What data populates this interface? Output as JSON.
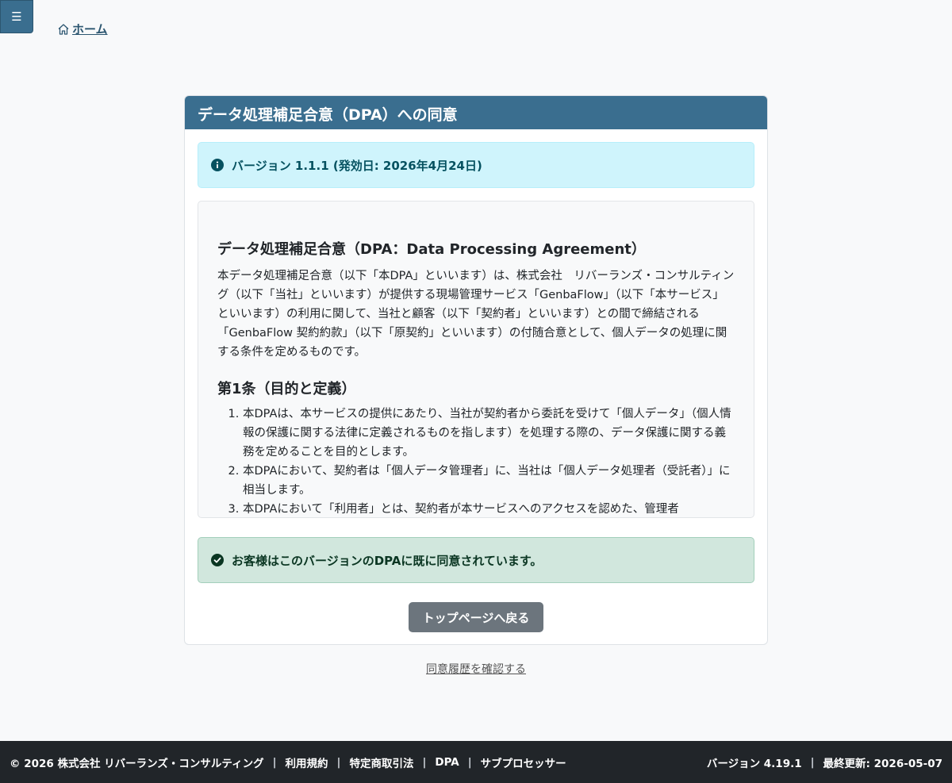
{
  "nav": {
    "menu_icon": "☰",
    "home_label": "ホーム"
  },
  "card": {
    "title": "データ処理補足合意（DPA）への同意"
  },
  "version_alert": {
    "text": "バージョン 1.1.1 (発効日: 2026年4月24日)"
  },
  "dpa": {
    "title": "データ処理補足合意（DPA：Data Processing Agreement）",
    "intro": "本データ処理補足合意（以下「本DPA」といいます）は、株式会社　リバーランズ・コンサルティング（以下「当社」といいます）が提供する現場管理サービス「GenbaFlow」（以下「本サービス」といいます）の利用に関して、当社と顧客（以下「契約者」といいます）との間で締結される「GenbaFlow 契約約款」（以下「原契約」といいます）の付随合意として、個人データの処理に関する条件を定めるものです。",
    "section1_title": "第1条（目的と定義）",
    "section1_items": [
      "本DPAは、本サービスの提供にあたり、当社が契約者から委託を受けて「個人データ」（個人情報の保護に関する法律に定義されるものを指します）を処理する際の、データ保護に関する義務を定めることを目的とします。",
      "本DPAにおいて、契約者は「個人データ管理者」に、当社は「個人データ処理者（受託者）」に相当します。",
      "本DPAにおいて「利用者」とは、契約者が本サービスへのアクセスを認めた、管理者"
    ]
  },
  "consent_alert": {
    "text": "お客様はこのバージョンのDPAに既に同意されています。"
  },
  "buttons": {
    "back_label": "トップページへ戻る"
  },
  "links": {
    "history_label": "同意履歴を確認する"
  },
  "footer": {
    "copyright": "© 2026 株式会社 リバーランズ・コンサルティング",
    "separator": "|",
    "terms": "利用規約",
    "tokusho": "特定商取引法",
    "dpa": "DPA",
    "subprocessors": "サブプロセッサー",
    "version": "バージョン 4.19.1",
    "updated": "最終更新: 2026-05-07"
  },
  "colors": {
    "primary": "#3a6e8f",
    "info_bg": "#cff4fc",
    "success_bg": "#d1e7dd",
    "secondary_button": "#6c757d",
    "footer_bg": "#212529"
  }
}
